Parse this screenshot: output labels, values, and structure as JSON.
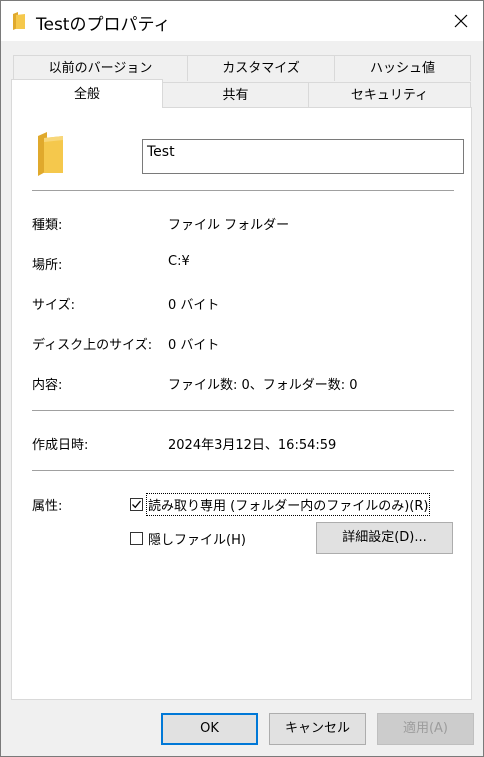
{
  "window": {
    "title": "Testのプロパティ",
    "folder_icon": "folder-icon",
    "close_icon": "close-icon"
  },
  "tabs": {
    "row_back": [
      "以前のバージョン",
      "カスタマイズ",
      "ハッシュ値"
    ],
    "row_front": [
      "全般",
      "共有",
      "セキュリティ"
    ],
    "active": "全般"
  },
  "general": {
    "name_value": "Test",
    "type_label": "種類:",
    "type_value": "ファイル フォルダー",
    "location_label": "場所:",
    "location_value": "C:¥",
    "size_label": "サイズ:",
    "size_value": "0 バイト",
    "disk_size_label": "ディスク上のサイズ:",
    "disk_size_value": "0 バイト",
    "contents_label": "内容:",
    "contents_value": "ファイル数: 0、フォルダー数: 0",
    "created_label": "作成日時:",
    "created_value": "2024年3月12日、16:54:59",
    "attributes_label": "属性:",
    "readonly_label": "読み取り専用 (フォルダー内のファイルのみ)(R)",
    "readonly_checked": true,
    "hidden_label": "隠しファイル(H)",
    "hidden_checked": false,
    "advanced_button": "詳細設定(D)..."
  },
  "footer": {
    "ok": "OK",
    "cancel": "キャンセル",
    "apply": "適用(A)"
  },
  "colors": {
    "folder": "#f5c84c",
    "folder_dark": "#e0a92c",
    "focus": "#0078d7"
  }
}
